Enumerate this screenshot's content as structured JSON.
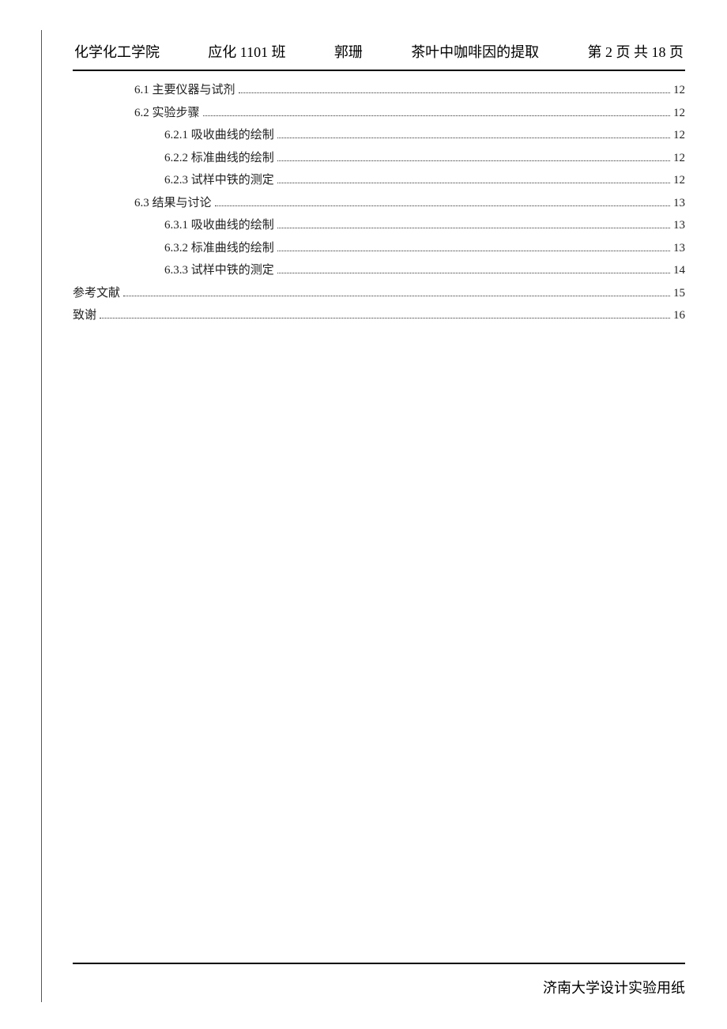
{
  "header": {
    "college": "化学化工学院",
    "class": "应化 1101 班",
    "author": "郭珊",
    "title": "茶叶中咖啡因的提取",
    "pagination": "第 2 页 共 18 页"
  },
  "toc": [
    {
      "level": 1,
      "label": "6.1 主要仪器与试剂",
      "page": "12"
    },
    {
      "level": 1,
      "label": "6.2 实验步骤",
      "page": "12"
    },
    {
      "level": 2,
      "label": "6.2.1 吸收曲线的绘制",
      "page": "12"
    },
    {
      "level": 2,
      "label": "6.2.2 标准曲线的绘制",
      "page": "12"
    },
    {
      "level": 2,
      "label": "6.2.3 试样中铁的测定",
      "page": "12"
    },
    {
      "level": 1,
      "label": "6.3 结果与讨论",
      "page": "13"
    },
    {
      "level": 2,
      "label": "6.3.1 吸收曲线的绘制",
      "page": "13"
    },
    {
      "level": 2,
      "label": "6.3.2 标准曲线的绘制",
      "page": "13"
    },
    {
      "level": 2,
      "label": "6.3.3 试样中铁的测定",
      "page": "14"
    },
    {
      "level": 0,
      "label": "参考文献",
      "page": "15"
    },
    {
      "level": 0,
      "label": "致谢",
      "page": "16"
    }
  ],
  "footer": "济南大学设计实验用纸"
}
